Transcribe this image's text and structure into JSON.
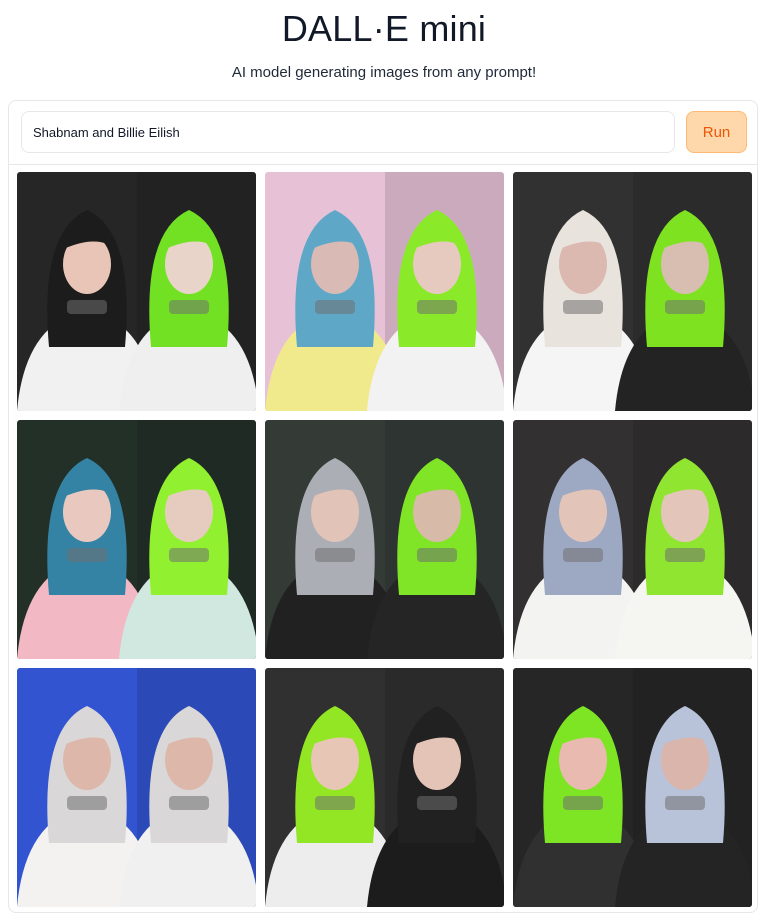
{
  "app": {
    "title": "DALL·E mini",
    "subtitle": "AI model generating images from any prompt!"
  },
  "prompt": {
    "value": "Shabnam and Billie Eilish"
  },
  "run_button": {
    "label": "Run"
  },
  "colors": {
    "accent_bg": "#fed7aa",
    "accent_text": "#ea580c",
    "neon_green": "#9be31b",
    "border": "#e5e7eb"
  },
  "gallery": {
    "images": [
      {
        "bg": "#1f1f1f",
        "left": {
          "hair": "#151515",
          "clothes": "#f1f1f1",
          "skin": "#e8c4b4"
        },
        "right": {
          "hair": "#6fe01c",
          "clothes": "#efefef",
          "skin": "#e9d3c8"
        }
      },
      {
        "bg": "#e7c0d6",
        "left": {
          "hair": "#5aa5c6",
          "clothes": "#f1ea8a",
          "skin": "#d9b8b2"
        },
        "right": {
          "hair": "#87ea23",
          "clothes": "#f2f2f2",
          "skin": "#e6c9be"
        }
      },
      {
        "bg": "#2b2b2b",
        "left": {
          "hair": "#e9e3dc",
          "clothes": "#f5f5f5",
          "skin": "#dab6ae"
        },
        "right": {
          "hair": "#7be21a",
          "clothes": "#1c1c1c",
          "skin": "#d7bcae"
        }
      },
      {
        "bg": "#1b2a20",
        "left": {
          "hair": "#2e7fa2",
          "clothes": "#f2b6c2",
          "skin": "#e9c8bd"
        },
        "right": {
          "hair": "#8ef02a",
          "clothes": "#cfe8df",
          "skin": "#e6cbbd"
        }
      },
      {
        "bg": "#2e3531",
        "left": {
          "hair": "#a9adb3",
          "clothes": "#1a1a1a",
          "skin": "#e2c2b6"
        },
        "right": {
          "hair": "#7be51f",
          "clothes": "#1e1e1e",
          "skin": "#d7b8a6"
        }
      },
      {
        "bg": "#2c2a2a",
        "left": {
          "hair": "#9aa6c2",
          "clothes": "#f3f3f1",
          "skin": "#e3c3b7"
        },
        "right": {
          "hair": "#8de52b",
          "clothes": "#f5f5f2",
          "skin": "#e4c4b8"
        }
      },
      {
        "bg": "#2c4fcf",
        "left": {
          "hair": "#d8d6d6",
          "clothes": "#f4f2f0",
          "skin": "#dcb5a8"
        },
        "right": {
          "hair": "#d8d6d6",
          "clothes": "#f0f0f0",
          "skin": "#dcb5a8"
        }
      },
      {
        "bg": "#2a2a2a",
        "left": {
          "hair": "#8fe61d",
          "clothes": "#ededed",
          "skin": "#e7c5b3"
        },
        "right": {
          "hair": "#1a1a1a",
          "clothes": "#151515",
          "skin": "#e4c3b5"
        }
      },
      {
        "bg": "#1f1f1f",
        "left": {
          "hair": "#7ae51d",
          "clothes": "#2a2a2a",
          "skin": "#e9b8ad"
        },
        "right": {
          "hair": "#b6c1d8",
          "clothes": "#1d1d1d",
          "skin": "#d9b3aa"
        }
      }
    ]
  }
}
